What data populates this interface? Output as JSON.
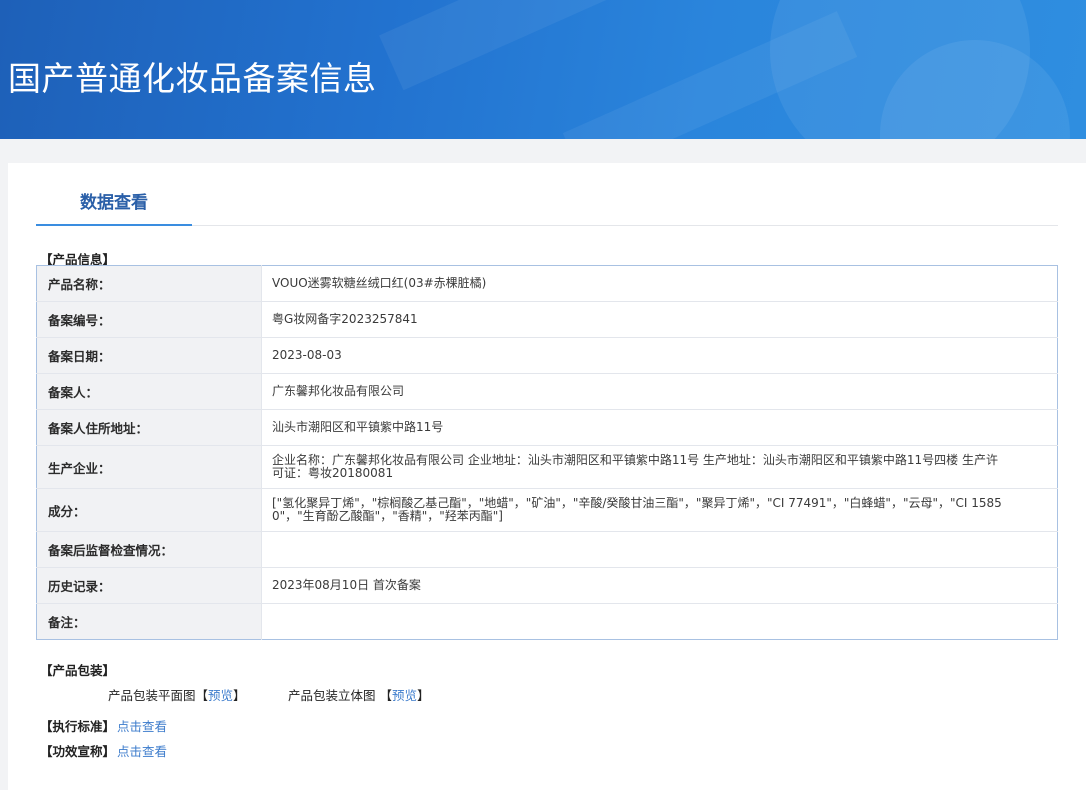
{
  "header": {
    "title": "国产普通化妆品备案信息"
  },
  "tabs": {
    "active_label": "数据查看"
  },
  "sections": {
    "product_info": "【产品信息】",
    "packaging": "【产品包装】",
    "standard": "【执行标准】",
    "efficacy": "【功效宣称】"
  },
  "product_info": [
    {
      "label": "产品名称：",
      "value": "VOUO迷雾软糖丝绒口红(03#赤棵脏橘)"
    },
    {
      "label": "备案编号：",
      "value": "粤G妆网备字2023257841"
    },
    {
      "label": "备案日期：",
      "value": "2023-08-03"
    },
    {
      "label": "备案人：",
      "value": "广东馨邦化妆品有限公司"
    },
    {
      "label": "备案人住所地址：",
      "value": "汕头市潮阳区和平镇紫中路11号"
    },
    {
      "label": "生产企业：",
      "value": "企业名称：广东馨邦化妆品有限公司 企业地址：汕头市潮阳区和平镇紫中路11号 生产地址：汕头市潮阳区和平镇紫中路11号四楼 生产许可证：粤妆20180081"
    },
    {
      "label": "成分：",
      "value": "[\"氢化聚异丁烯\"，\"棕榈酸乙基己酯\"，\"地蜡\"，\"矿油\"，\"辛酸/癸酸甘油三酯\"，\"聚异丁烯\"，\"CI 77491\"，\"白蜂蜡\"，\"云母\"，\"CI 15850\"，\"生育酚乙酸酯\"，\"香精\"，\"羟苯丙酯\"]"
    },
    {
      "label": "备案后监督检查情况：",
      "value": ""
    },
    {
      "label": "历史记录：",
      "value": "2023年08月10日 首次备案"
    },
    {
      "label": "备注：",
      "value": ""
    }
  ],
  "packaging": {
    "flat_label": "产品包装平面图",
    "flat_link": "预览",
    "solid_label": "产品包装立体图",
    "solid_link": "预览",
    "bracket_open": "【",
    "bracket_close": "】"
  },
  "links": {
    "standard": "点击查看",
    "efficacy": "点击查看"
  }
}
